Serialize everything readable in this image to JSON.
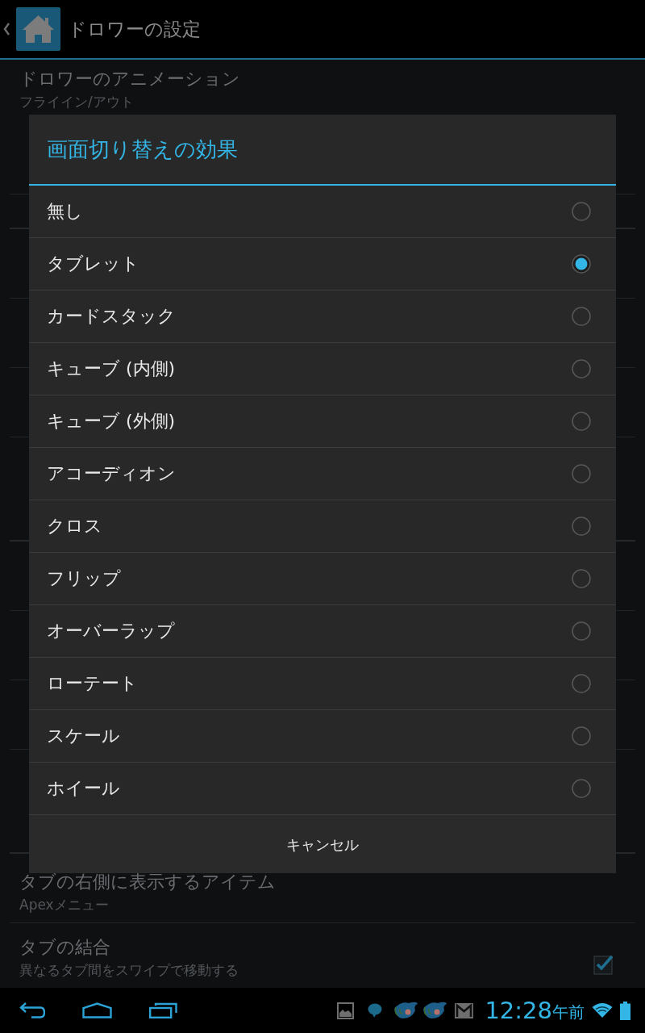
{
  "action_bar": {
    "title": "ドロワーの設定"
  },
  "settings_top": [
    {
      "kind": "item",
      "title": "ドロワーのアニメーション",
      "summary": "フライイン/アウト"
    }
  ],
  "settings_bottom": [
    {
      "kind": "item",
      "title": "タブの右側に表示するアイテム",
      "summary": "Apexメニュー"
    },
    {
      "kind": "check",
      "title": "タブの結合",
      "summary": "異なるタブ間をスワイプで移動する",
      "checked": true
    }
  ],
  "dialog": {
    "title": "画面切り替えの効果",
    "options": [
      {
        "label": "無し",
        "selected": false
      },
      {
        "label": "タブレット",
        "selected": true
      },
      {
        "label": "カードスタック",
        "selected": false
      },
      {
        "label": "キューブ (内側)",
        "selected": false
      },
      {
        "label": "キューブ (外側)",
        "selected": false
      },
      {
        "label": "アコーディオン",
        "selected": false
      },
      {
        "label": "クロス",
        "selected": false
      },
      {
        "label": "フリップ",
        "selected": false
      },
      {
        "label": "オーバーラップ",
        "selected": false
      },
      {
        "label": "ローテート",
        "selected": false
      },
      {
        "label": "スケール",
        "selected": false
      },
      {
        "label": "ホイール",
        "selected": false
      }
    ],
    "cancel": "キャンセル"
  },
  "status_bar": {
    "time": "12:28",
    "period": "午前"
  }
}
